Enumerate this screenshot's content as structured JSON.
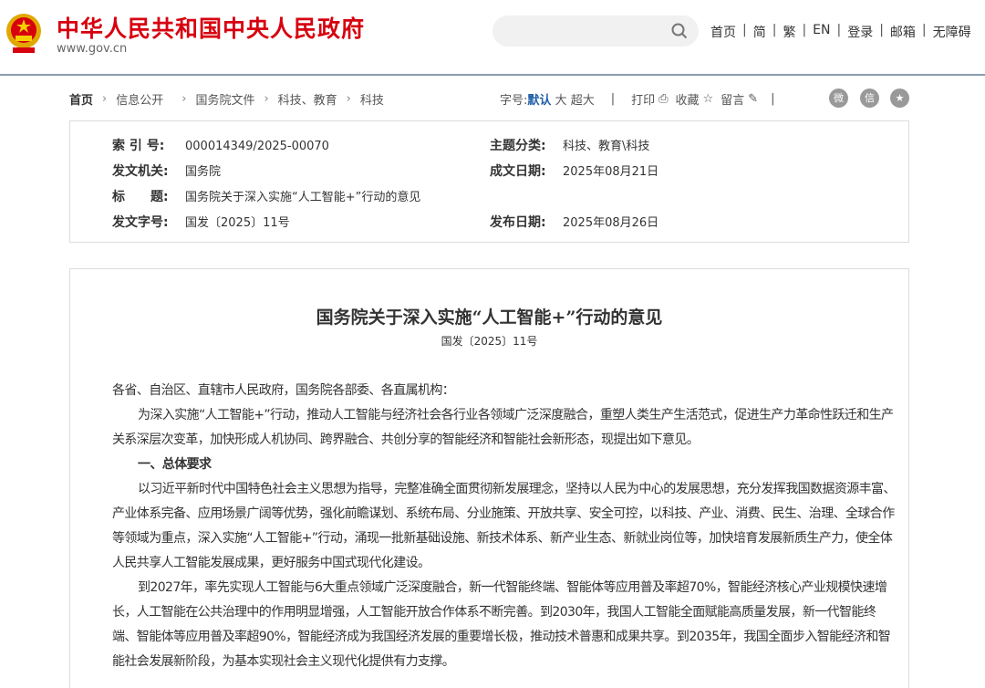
{
  "header": {
    "site_title": "中华人民共和国中央人民政府",
    "site_url": "www.gov.cn",
    "search_placeholder": "",
    "nav": [
      "首页",
      "简",
      "繁",
      "EN",
      "登录",
      "邮箱",
      "无障碍"
    ]
  },
  "breadcrumb": [
    "首页",
    "信息公开",
    "国务院文件",
    "科技、教育",
    "科技"
  ],
  "tools": {
    "font_label": "字号:",
    "font_default": "默认",
    "font_large": "大",
    "font_xlarge": "超大",
    "print": "打印",
    "favorite": "收藏",
    "comment": "留言",
    "sep": "|"
  },
  "info": {
    "index_label": "索 引 号:",
    "index": "000014349/2025-00070",
    "topic_label": "主题分类:",
    "topic": "科技、教育\\科技",
    "issuer_label": "发文机关:",
    "issuer": "国务院",
    "created_label": "成文日期:",
    "created": "2025年08月21日",
    "title_label": "标　　题:",
    "title": "国务院关于深入实施“人工智能+”行动的意见",
    "docno_label": "发文字号:",
    "docno": "国发〔2025〕11号",
    "published_label": "发布日期:",
    "published": "2025年08月26日"
  },
  "document": {
    "title": "国务院关于深入实施“人工智能+”行动的意见",
    "number": "国发〔2025〕11号",
    "paragraphs": [
      "各省、自治区、直辖市人民政府，国务院各部委、各直属机构：",
      "为深入实施“人工智能+”行动，推动人工智能与经济社会各行业各领域广泛深度融合，重塑人类生产生活范式，促进生产力革命性跃迁和生产关系深层次变革，加快形成人机协同、跨界融合、共创分享的智能经济和智能社会新形态，现提出如下意见。",
      "一、总体要求",
      "以习近平新时代中国特色社会主义思想为指导，完整准确全面贯彻新发展理念，坚持以人民为中心的发展思想，充分发挥我国数据资源丰富、产业体系完备、应用场景广阔等优势，强化前瞻谋划、系统布局、分业施策、开放共享、安全可控，以科技、产业、消费、民生、治理、全球合作等领域为重点，深入实施“人工智能+”行动，涌现一批新基础设施、新技术体系、新产业生态、新就业岗位等，加快培育发展新质生产力，使全体人民共享人工智能发展成果，更好服务中国式现代化建设。",
      "到2027年，率先实现人工智能与6大重点领域广泛深度融合，新一代智能终端、智能体等应用普及率超70%，智能经济核心产业规模快速增长，人工智能在公共治理中的作用明显增强，人工智能开放合作体系不断完善。到2030年，我国人工智能全面赋能高质量发展，新一代智能终端、智能体等应用普及率超90%，智能经济成为我国经济发展的重要增长极，推动技术普惠和成果共享。到2035年，我国全面步入智能经济和智能社会发展新阶段，为基本实现社会主义现代化提供有力支撑。"
    ]
  },
  "colors": {
    "brand_red": "#d7000f",
    "link_blue": "#1e5fa8"
  }
}
